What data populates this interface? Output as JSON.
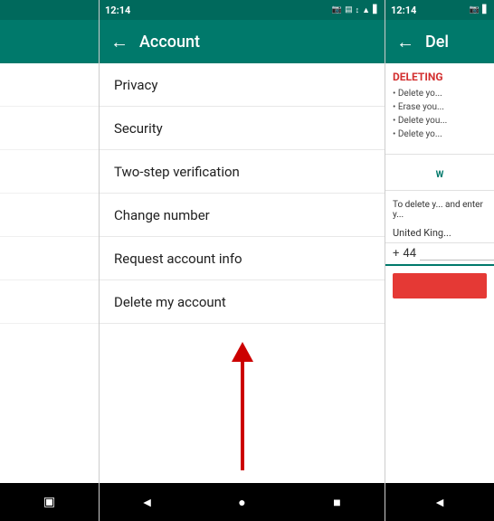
{
  "left_panel": {
    "status_bar": {
      "color": "#00695c"
    },
    "nav_bar": {
      "items": [
        {
          "icon": "▣",
          "name": "square-icon"
        }
      ]
    }
  },
  "middle_panel": {
    "status_bar": {
      "time": "12:14",
      "icons": [
        "📷",
        "▤",
        "↕",
        "🔋"
      ]
    },
    "app_bar": {
      "back_icon": "←",
      "title": "Account"
    },
    "menu_items": [
      {
        "label": "Privacy"
      },
      {
        "label": "Security"
      },
      {
        "label": "Two-step verification"
      },
      {
        "label": "Change number"
      },
      {
        "label": "Request account info"
      },
      {
        "label": "Delete my account"
      }
    ],
    "nav_bar": {
      "back_icon": "◄",
      "home_icon": "●",
      "recent_icon": "■"
    }
  },
  "right_panel": {
    "status_bar": {
      "time": "12:14",
      "icons": [
        "📷",
        "🔋"
      ]
    },
    "app_bar": {
      "back_icon": "←",
      "title": "Del"
    },
    "delete_section": {
      "title": "DELETING",
      "bullets": [
        "• Delete yo...",
        "• Erase you...",
        "• Delete you...",
        "• Delete yo..."
      ],
      "warning_text": "To delete y... and enter y...",
      "country_label": "United King...",
      "phone_code": "44",
      "phone_plus": "+"
    },
    "nav_bar": {
      "back_icon": "◄"
    }
  },
  "arrow": {
    "color": "#cc0000"
  }
}
